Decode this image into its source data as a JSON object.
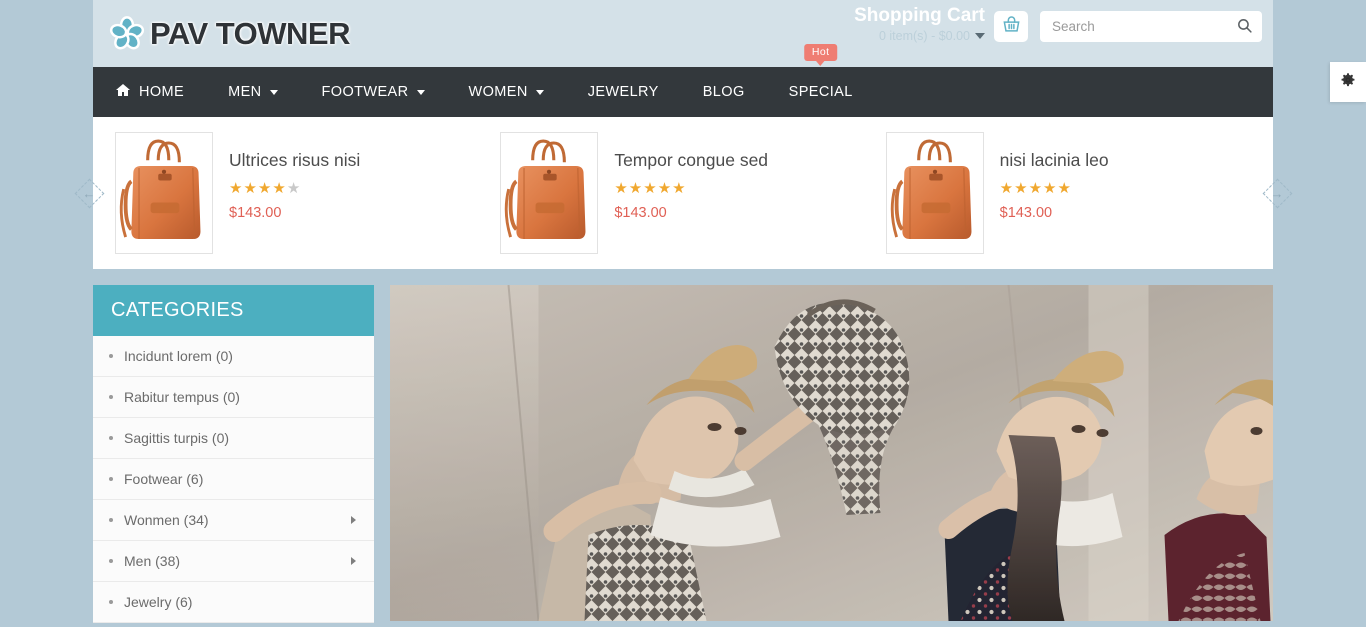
{
  "brand": {
    "name": "PAV TOWNER",
    "logo_icon": "flower-icon",
    "accent_teal": "#4cafc0",
    "nav_dark": "#33383c",
    "page_bg": "#b3c9d6",
    "header_bg": "#d4e1e8",
    "price_color": "#e06055",
    "badge_color": "#ef7d72"
  },
  "header": {
    "cart": {
      "title": "Shopping Cart",
      "summary": "0 item(s) - $0.00",
      "caret_icon": "chevron-down-icon",
      "basket_icon": "shopping-basket-icon"
    },
    "search": {
      "placeholder": "Search",
      "value": "",
      "icon": "search-icon"
    }
  },
  "nav": {
    "items": [
      {
        "label": "HOME",
        "icon": "home-icon",
        "has_dropdown": false,
        "badge": ""
      },
      {
        "label": "MEN",
        "icon": "",
        "has_dropdown": true,
        "badge": ""
      },
      {
        "label": "FOOTWEAR",
        "icon": "",
        "has_dropdown": true,
        "badge": ""
      },
      {
        "label": "WOMEN",
        "icon": "",
        "has_dropdown": true,
        "badge": ""
      },
      {
        "label": "JEWELRY",
        "icon": "",
        "has_dropdown": false,
        "badge": ""
      },
      {
        "label": "BLOG",
        "icon": "",
        "has_dropdown": false,
        "badge": ""
      },
      {
        "label": "SPECIAL",
        "icon": "",
        "has_dropdown": false,
        "badge": "Hot"
      }
    ]
  },
  "carousel": {
    "prev_icon": "arrow-left-icon",
    "next_icon": "arrow-right-icon",
    "products": [
      {
        "name": "Ultrices risus nisi",
        "rating": 4,
        "max_rating": 5,
        "price": "$143.00",
        "image": "handbag-orange"
      },
      {
        "name": "Tempor congue sed",
        "rating": 5,
        "max_rating": 5,
        "price": "$143.00",
        "image": "handbag-orange"
      },
      {
        "name": "nisi lacinia leo",
        "rating": 5,
        "max_rating": 5,
        "price": "$143.00",
        "image": "handbag-orange"
      }
    ]
  },
  "sidebar": {
    "title": "CATEGORIES",
    "items": [
      {
        "label": "Incidunt lorem (0)",
        "has_children": false
      },
      {
        "label": "Rabitur tempus (0)",
        "has_children": false
      },
      {
        "label": "Sagittis turpis (0)",
        "has_children": false
      },
      {
        "label": "Footwear (6)",
        "has_children": false
      },
      {
        "label": "Wonmen (34)",
        "has_children": true
      },
      {
        "label": "Men (38)",
        "has_children": true
      },
      {
        "label": "Jewelry (6)",
        "has_children": false
      }
    ]
  },
  "hero": {
    "alt": "fashion models group editorial photo"
  },
  "settings": {
    "icon": "gear-icon"
  }
}
